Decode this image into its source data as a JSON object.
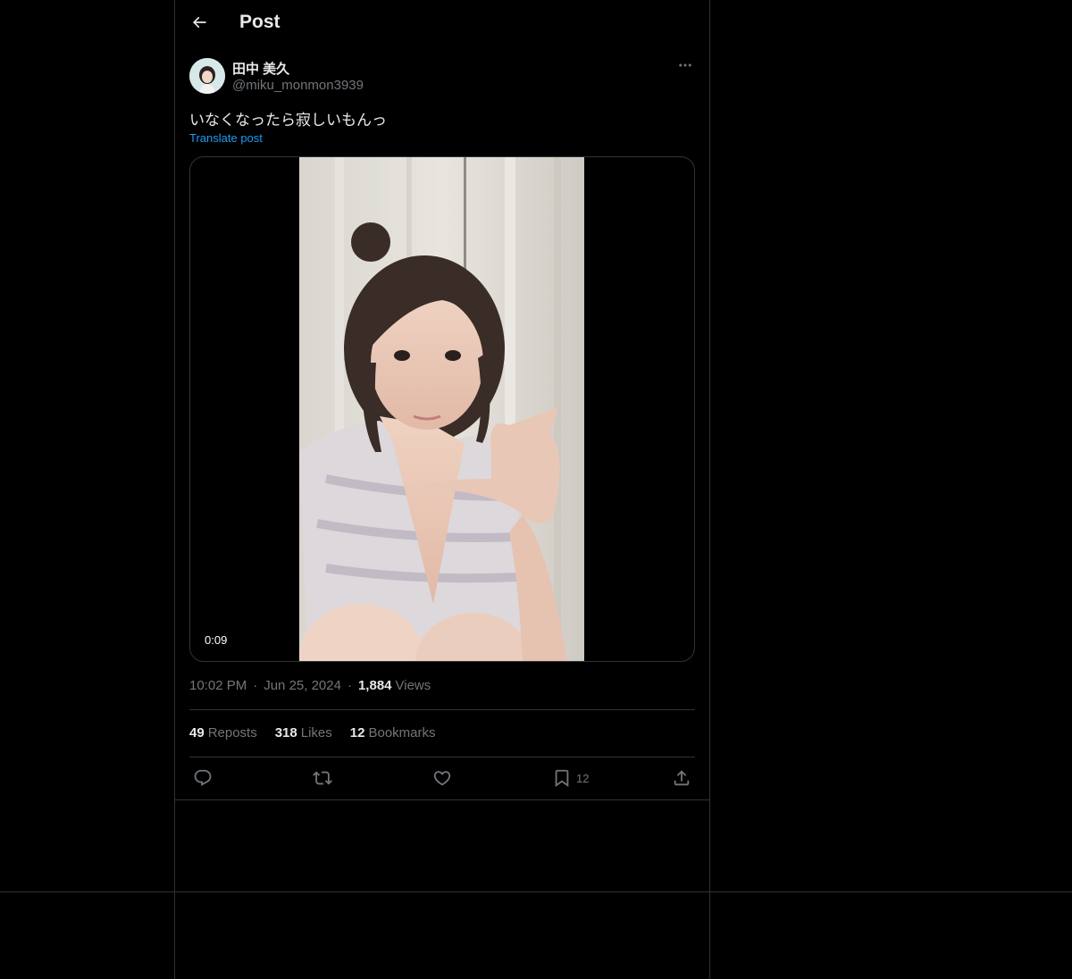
{
  "header": {
    "title": "Post"
  },
  "post": {
    "author_name": "田中 美久",
    "author_handle": "@miku_monmon3939",
    "text": "いなくなったら寂しいもんっ",
    "translate_label": "Translate post",
    "media": {
      "duration": "0:09"
    },
    "time": "10:02 PM",
    "date": "Jun 25, 2024",
    "separator": "·",
    "views_count": "1,884",
    "views_label": "Views"
  },
  "stats": {
    "reposts_count": "49",
    "reposts_label": "Reposts",
    "likes_count": "318",
    "likes_label": "Likes",
    "bookmarks_count": "12",
    "bookmarks_label": "Bookmarks"
  },
  "actions": {
    "bookmark_count": "12",
    "icons": [
      "reply-icon",
      "repost-icon",
      "like-icon",
      "bookmark-icon",
      "share-icon"
    ]
  },
  "colors": {
    "background": "#000000",
    "text_primary": "#e7e9ea",
    "text_secondary": "#71767b",
    "link": "#1d9bf0",
    "border": "#2f3336"
  }
}
